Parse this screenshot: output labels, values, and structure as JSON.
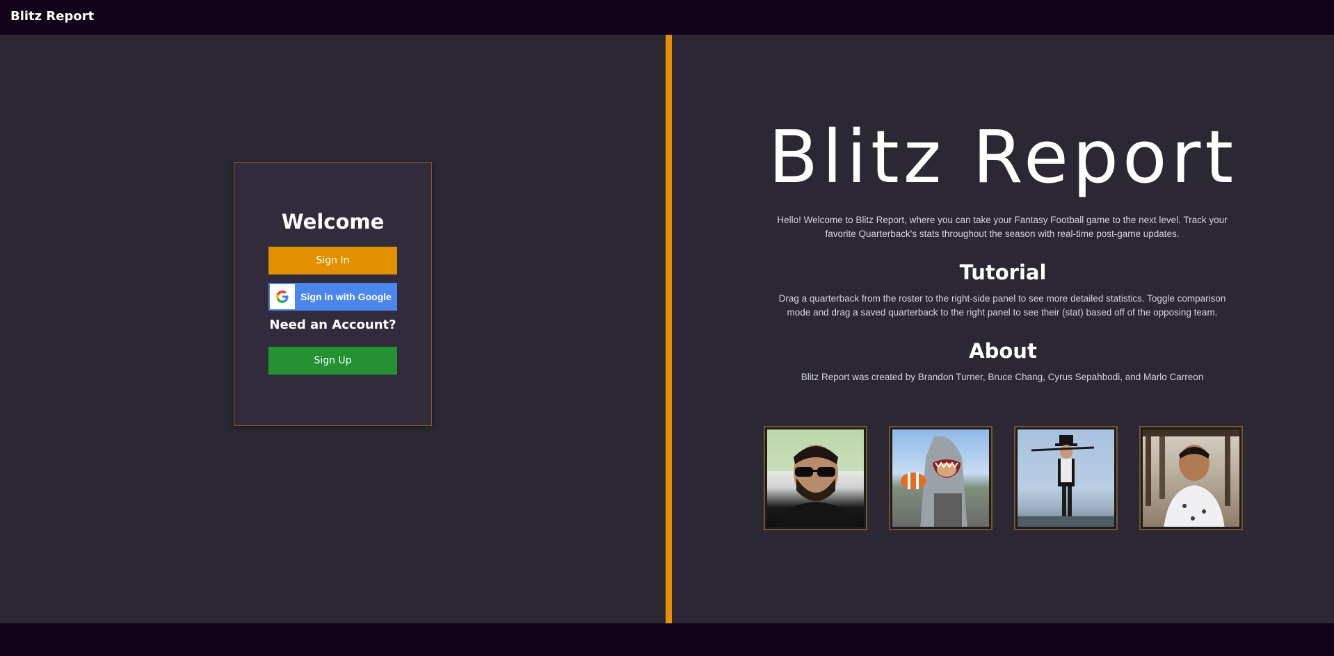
{
  "navbar": {
    "brand": "Blitz Report"
  },
  "login": {
    "welcome": "Welcome",
    "sign_in_label": "Sign In",
    "google_label": "Sign in with Google",
    "need_account": "Need an Account?",
    "sign_up_label": "Sign Up"
  },
  "hero": {
    "title": "Blitz Report",
    "intro": "Hello! Welcome to Blitz Report, where you can take your Fantasy Football game to the next level. Track your favorite Quarterback's stats throughout the season with real-time post-game updates."
  },
  "tutorial": {
    "heading": "Tutorial",
    "text": "Drag a quarterback from the roster to the right-side panel to see more detailed statistics. Toggle comparison mode and drag a saved quarterback to the right panel to see their (stat) based off of the opposing team."
  },
  "about": {
    "heading": "About",
    "text": "Blitz Report was created by Brandon Turner, Bruce Chang, Cyrus Sepahbodi, and Marlo Carreon"
  },
  "team_photos": [
    "team-member-photo",
    "team-member-photo",
    "team-member-photo",
    "team-member-photo"
  ],
  "colors": {
    "accent": "#e48f00",
    "navbar": "#13031a",
    "background": "#2b2833",
    "card": "#322b3b",
    "sign_in": "#e39000",
    "google": "#4a86eb",
    "sign_up": "#249133"
  }
}
